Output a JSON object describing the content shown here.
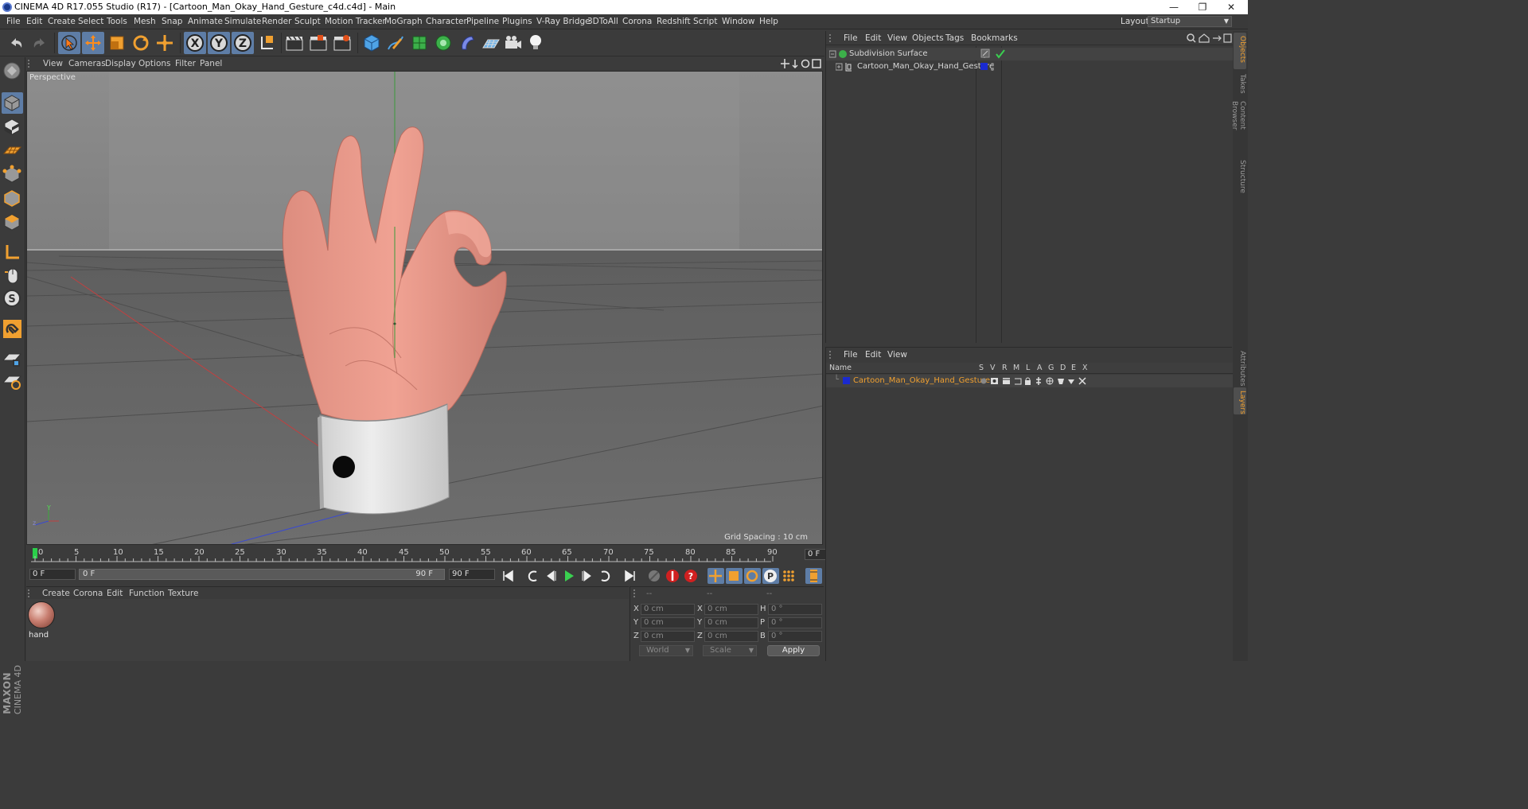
{
  "window": {
    "title": "CINEMA 4D R17.055 Studio (R17) - [Cartoon_Man_Okay_Hand_Gesture_c4d.c4d] - Main",
    "minimize": "—",
    "maximize": "❐",
    "close": "✕"
  },
  "menubar": {
    "items": [
      "File",
      "Edit",
      "Create",
      "Select",
      "Tools",
      "Mesh",
      "Snap",
      "Animate",
      "Simulate",
      "Render",
      "Sculpt",
      "Motion Tracker",
      "MoGraph",
      "Character",
      "Pipeline",
      "Plugins",
      "V-Ray Bridge",
      "3DToAll",
      "Corona",
      "Redshift",
      "Script",
      "Window",
      "Help"
    ],
    "layout_label": "Layout:",
    "layout_value": "Startup"
  },
  "viewport": {
    "menu": [
      "View",
      "Cameras",
      "Display",
      "Options",
      "Filter",
      "Panel"
    ],
    "label": "Perspective",
    "grid_spacing": "Grid Spacing : 10 cm"
  },
  "timeline": {
    "ticks": [
      "0",
      "5",
      "10",
      "15",
      "20",
      "25",
      "30",
      "35",
      "40",
      "45",
      "50",
      "55",
      "60",
      "65",
      "70",
      "75",
      "80",
      "85",
      "90"
    ],
    "current_frame": "0 F"
  },
  "transport": {
    "start_field": "0 F",
    "range_start": "0 F",
    "range_end": "90 F",
    "end_field": "90 F"
  },
  "material_manager": {
    "menu": [
      "Create",
      "Corona",
      "Edit",
      "Function",
      "Texture"
    ],
    "material_name": "hand"
  },
  "coordinates": {
    "header": [
      "--",
      "--",
      "--"
    ],
    "rows": [
      {
        "l1": "X",
        "v1": "0 cm",
        "l2": "X",
        "v2": "0 cm",
        "l3": "H",
        "v3": "0 °"
      },
      {
        "l1": "Y",
        "v1": "0 cm",
        "l2": "Y",
        "v2": "0 cm",
        "l3": "P",
        "v3": "0 °"
      },
      {
        "l1": "Z",
        "v1": "0 cm",
        "l2": "Z",
        "v2": "0 cm",
        "l3": "B",
        "v3": "0 °"
      }
    ],
    "space": "World",
    "mode": "Scale",
    "apply": "Apply"
  },
  "object_manager": {
    "menu": [
      "File",
      "Edit",
      "View",
      "Objects",
      "Tags",
      "Bookmarks"
    ],
    "objects": [
      {
        "name": "Subdivision Surface"
      },
      {
        "name": "Cartoon_Man_Okay_Hand_Gesture"
      }
    ]
  },
  "layer_manager": {
    "menu": [
      "File",
      "Edit",
      "View"
    ],
    "columns": [
      "Name",
      "S",
      "V",
      "R",
      "M",
      "L",
      "A",
      "G",
      "D",
      "E",
      "X"
    ],
    "layers": [
      {
        "name": "Cartoon_Man_Okay_Hand_Gesture",
        "color": "#1a2ad0"
      }
    ]
  },
  "right_tabs": [
    "Objects",
    "Takes",
    "Content Browser",
    "Structure",
    "Attributes",
    "Layers"
  ],
  "brand": {
    "line1": "MAXON",
    "line2": "CINEMA 4D"
  },
  "colors": {
    "accent": "#5e7da6",
    "highlight": "#f0a030",
    "layer_blue": "#1a2ad0"
  }
}
